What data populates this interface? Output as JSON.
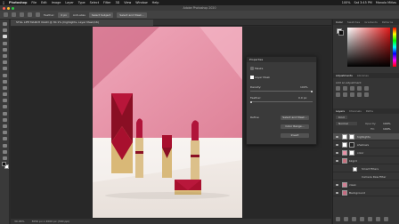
{
  "menubar": {
    "app_name": "Photoshop",
    "items": [
      "File",
      "Edit",
      "Image",
      "Layer",
      "Type",
      "Select",
      "Filter",
      "3D",
      "View",
      "Window",
      "Help"
    ],
    "right_items": [
      "100%",
      "Sat 3:45 PM",
      "Manolo Miñas"
    ]
  },
  "window": {
    "title": "Adobe Photoshop 2020"
  },
  "options_bar": {
    "feather_label": "Feather:",
    "feather_value": "0 px",
    "anti_alias_label": "Anti-alias",
    "select_subject_label": "Select Subject",
    "select_mask_label": "Select and Mask..."
  },
  "document_tab": {
    "label": "STILL LIFE MARCH VALID @ 30.1% (highlights, Layer Mask/16)"
  },
  "status_bar": {
    "zoom": "30.06%",
    "info": "3056 px x 4000 px (300 ppi)"
  },
  "properties": {
    "title": "Properties",
    "masks_label": "Masks",
    "layer_mask_label": "Layer Mask",
    "density_label": "Density:",
    "density_value": "100%",
    "feather_label": "Feather:",
    "feather_value": "0.0 px",
    "refine_label": "Refine:",
    "select_and_mask_label": "Select and Mask...",
    "color_range_label": "Color Range...",
    "invert_label": "Invert"
  },
  "right_panel": {
    "color_tabs": [
      "Color",
      "Swatches",
      "Gradients",
      "Patterns"
    ],
    "adjustments_tabs": [
      "Adjustments",
      "Libraries"
    ],
    "add_adjustment_label": "Add an adjustment",
    "layers_tabs": [
      "Layers",
      "Channels",
      "Paths"
    ],
    "kind_label": "Kind",
    "blend_mode": "Normal",
    "opacity_label": "Opacity:",
    "opacity_value": "100%",
    "fill_label": "Fill:",
    "fill_value": "100%",
    "layers": [
      {
        "name": "highlights",
        "selected": true
      },
      {
        "name": "shadows",
        "selected": false
      },
      {
        "name": "color",
        "selected": false
      },
      {
        "name": "bkgrd",
        "selected": false
      },
      {
        "name": "Smart Filters",
        "selected": false
      },
      {
        "name": "Camera Raw Filter",
        "selected": false
      },
      {
        "name": "clean",
        "selected": false
      },
      {
        "name": "Background",
        "selected": false
      }
    ]
  },
  "colors": {
    "accent": "#2d8ceb",
    "wall": "#e890a6",
    "floor": "#f0ebe6",
    "lipstick": "#a8102e",
    "gold": "#d8b97a"
  }
}
